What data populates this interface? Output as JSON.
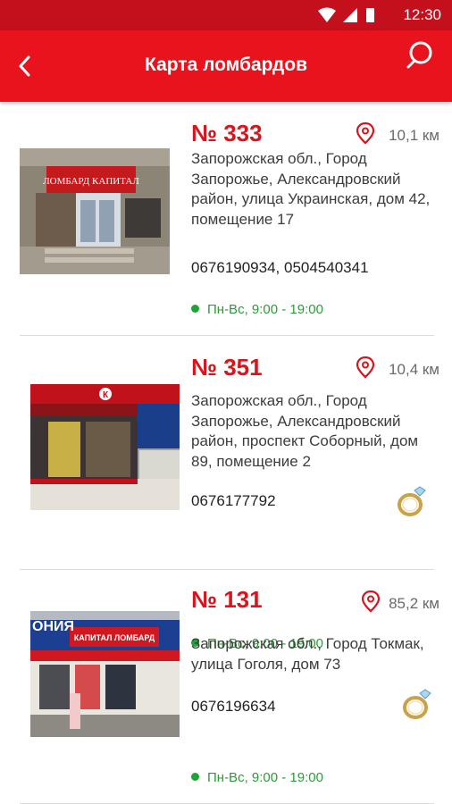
{
  "status_bar": {
    "time": "12:30",
    "icons": [
      "wifi-icon",
      "signal-icon",
      "battery-icon"
    ]
  },
  "app_bar": {
    "title": "Карта ломбардов",
    "back_icon": "arrow-back-icon",
    "search_icon": "search-icon"
  },
  "colors": {
    "primary": "#e8131d",
    "status_bar": "#c4101c",
    "open_status": "#1da336"
  },
  "shops": [
    {
      "number": "№ 333",
      "distance": "10,1 км",
      "address": "Запорожская обл., Город Запорожье, Александровский район, улица Украинская, дом 42, помещение 17",
      "phones": "0676190934, 0504540341",
      "hours": "Пн-Вс, 9:00 - 19:00",
      "photo_sign": "ЛОМБАРД КАПИТАЛ",
      "has_gold_badge": false
    },
    {
      "number": "№ 351",
      "distance": "10,4 км",
      "address": "Запорожская обл., Город Запорожье, Александровский район, проспект Соборный, дом 89, помещение 2",
      "phones": "0676177792",
      "hours": "Пн-Вс, 9:00 - 19:00",
      "photo_sign": "К",
      "has_gold_badge": true
    },
    {
      "number": "№ 131",
      "distance": "85,2 км",
      "address": "Запорожская обл., Город Токмак, улица Гоголя, дом 73",
      "phones": "0676196634",
      "hours": "Пн-Вс, 9:00 - 19:00",
      "photo_sign": "КАПИТАЛ ЛОМБАРД",
      "photo_sign_top": "ОНИЯ",
      "has_gold_badge": true
    }
  ]
}
